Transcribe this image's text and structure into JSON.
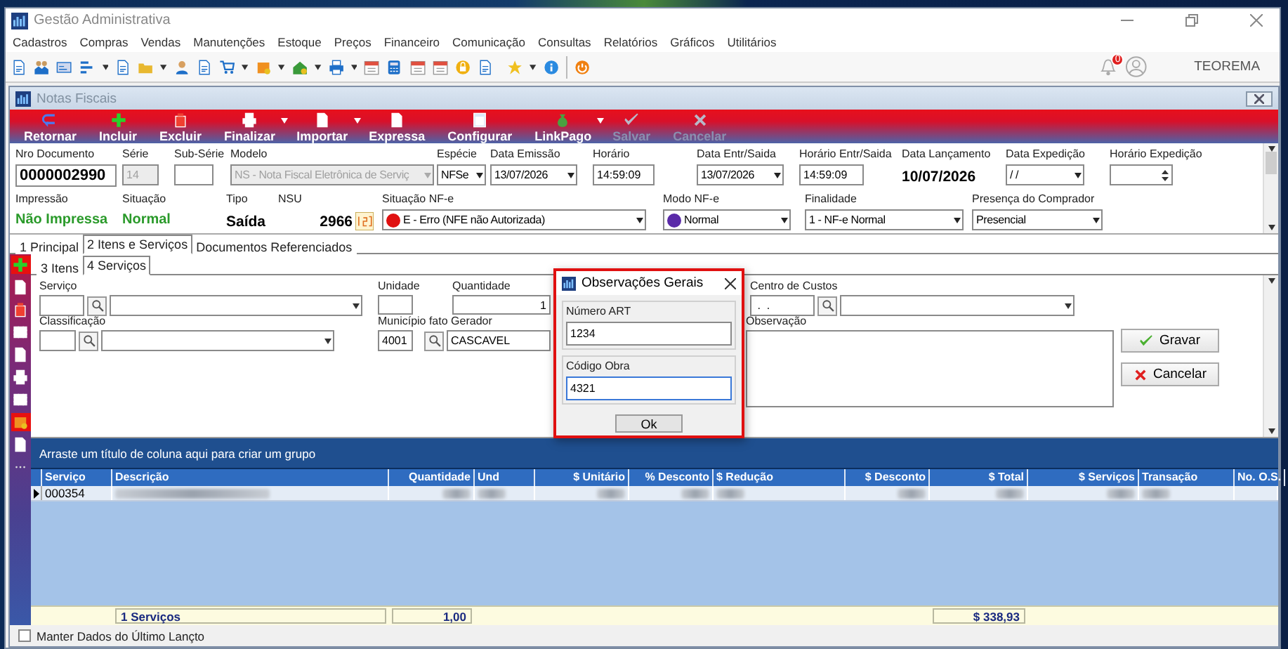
{
  "window": {
    "title": "Gestão Administrativa"
  },
  "menu": [
    "Cadastros",
    "Compras",
    "Vendas",
    "Manutenções",
    "Estoque",
    "Preços",
    "Financeiro",
    "Comunicação",
    "Consultas",
    "Relatórios",
    "Gráficos",
    "Utilitários"
  ],
  "user": {
    "notifications": "0",
    "name": "TEOREMA"
  },
  "document_window": {
    "title": "Notas Fiscais"
  },
  "actions": [
    {
      "label": "Retornar",
      "kind": "return",
      "disabled": false,
      "dropdown": false
    },
    {
      "label": "Incluir",
      "kind": "plus",
      "disabled": false,
      "dropdown": false
    },
    {
      "label": "Excluir",
      "kind": "trash",
      "disabled": false,
      "dropdown": false
    },
    {
      "label": "Finalizar",
      "kind": "printer",
      "disabled": false,
      "dropdown": true
    },
    {
      "label": "Importar",
      "kind": "document",
      "disabled": false,
      "dropdown": true
    },
    {
      "label": "Expressa",
      "kind": "document",
      "disabled": false,
      "dropdown": false
    },
    {
      "label": "Configurar",
      "kind": "window",
      "disabled": false,
      "dropdown": false
    },
    {
      "label": "LinkPago",
      "kind": "money",
      "disabled": false,
      "dropdown": true
    },
    {
      "label": "Salvar",
      "kind": "check",
      "disabled": true,
      "dropdown": false
    },
    {
      "label": "Cancelar",
      "kind": "cross",
      "disabled": true,
      "dropdown": false
    }
  ],
  "header_row_1": [
    {
      "label": "Nro Documento",
      "value": "0000002990",
      "kind": "big"
    },
    {
      "label": "Série",
      "value": "14",
      "kind": "input",
      "disabled": true
    },
    {
      "label": "Sub-Série",
      "kind": "input",
      "disabled": false
    },
    {
      "label": "Modelo",
      "value": "NS - Nota Fiscal Eletrônica de Serviç",
      "kind": "select",
      "disabled": true
    },
    {
      "label": "Espécie",
      "value": "NFSe",
      "kind": "select",
      "disabled": false
    },
    {
      "label": "Data Emissão",
      "value": "13/07/2026",
      "kind": "select",
      "disabled": false
    },
    {
      "label": "Horário",
      "value": "14:59:09",
      "kind": "input",
      "disabled": false
    },
    {
      "label": "Data Entr/Saida",
      "value": "13/07/2026",
      "kind": "select",
      "disabled": false
    },
    {
      "label": "Horário Entr/Saida",
      "value": "14:59:09",
      "kind": "input",
      "disabled": false
    },
    {
      "label": "Data Lançamento",
      "value": "10/07/2026",
      "kind": "bold"
    },
    {
      "label": "Data Expedição",
      "value": "/ /",
      "kind": "select",
      "disabled": false
    },
    {
      "label": "Horário Expedição",
      "kind": "spin"
    }
  ],
  "header_row_2": [
    {
      "label": "Impressão",
      "value": "Não Impressa",
      "kind": "status"
    },
    {
      "label": "Situação",
      "value": "Normal",
      "kind": "status"
    },
    {
      "label": "Tipo",
      "value": "Saída",
      "kind": "bold"
    },
    {
      "label": "NSU",
      "value": "2966",
      "kind": "nsu"
    },
    {
      "label": "Situação NF-e",
      "value": "E - Erro (NFE não Autorizada)",
      "kind": "dot_select",
      "color": "#e01010"
    },
    {
      "label": "Modo NF-e",
      "value": "Normal",
      "kind": "dot_select",
      "color": "#5a2aa8"
    },
    {
      "label": "Finalidade",
      "value": "1 - NF-e Normal",
      "kind": "select"
    },
    {
      "label": "Presença do Comprador",
      "value": "Presencial",
      "kind": "select"
    }
  ],
  "tabs": [
    {
      "label": "1 Principal",
      "selected": false
    },
    {
      "label": "2 Itens e Serviços",
      "selected": true
    },
    {
      "label": "Documentos Referenciados",
      "selected": false
    }
  ],
  "subtabs": [
    {
      "label": "3 Itens",
      "selected": false
    },
    {
      "label": "4 Serviços",
      "selected": true
    }
  ],
  "service_form": {
    "service_label": "Serviço",
    "unit_label": "Unidade",
    "quantity_label": "Quantidade",
    "quantity": "1",
    "cost_center_label": "Centro de Custos",
    "cost_center": " .  .",
    "classification_label": "Classificação",
    "city_label": "Município fato Gerador",
    "city_code": "4001",
    "city": "CASCAVEL",
    "notes_label": "Observação",
    "buttons": [
      {
        "label": "Gravar",
        "kind": "check"
      },
      {
        "label": "Cancelar",
        "kind": "cross"
      }
    ]
  },
  "dialog": {
    "title": "Observações Gerais",
    "fields": [
      {
        "label": "Número ART",
        "value": "1234",
        "focused": false
      },
      {
        "label": "Código Obra",
        "value": "4321",
        "focused": true
      }
    ],
    "button": "Ok"
  },
  "grid": {
    "group_hint": "Arraste um título de coluna aqui para criar um grupo",
    "columns": [
      "Serviço",
      "Descrição",
      "Quantidade",
      "Und",
      "$ Unitário",
      "% Desconto",
      "$ Redução",
      "$ Desconto",
      "$ Total",
      "$ Serviços",
      "Transação",
      "No. O.S."
    ],
    "rows": [
      {
        "service": "000354",
        "current": true
      }
    ],
    "totals": {
      "count": "1 Serviços",
      "quantity": "1,00",
      "total": "$ 338,93"
    }
  },
  "keep_last": {
    "label": "Manter Dados do Último Lançto",
    "checked": false
  }
}
